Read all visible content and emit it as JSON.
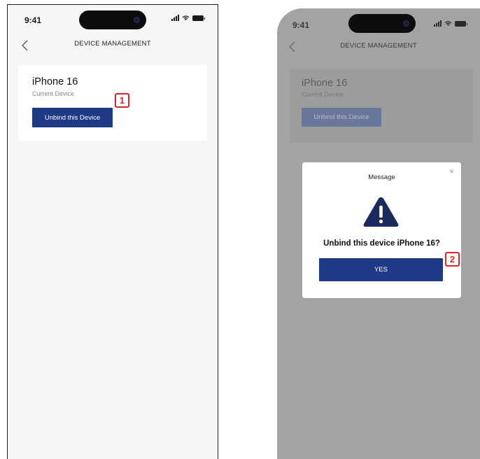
{
  "status_bar": {
    "time": "9:41"
  },
  "screen1": {
    "title": "DEVICE MANAGEMENT",
    "device_name": "iPhone 16",
    "device_subtitle": "Current Device",
    "unbind_label": "Unbind this Device",
    "step_marker": "1"
  },
  "screen2": {
    "title": "DEVICE MANAGEMENT",
    "device_name": "iPhone 16",
    "device_subtitle": "Current Device",
    "unbind_label": "Unbind this Device",
    "dialog": {
      "title": "Message",
      "close": "×",
      "question": "Unbind this device iPhone 16?",
      "yes_label": "YES"
    },
    "step_marker": "2"
  },
  "colors": {
    "primary": "#1e3a86",
    "overlay": "#a3a3a3",
    "marker": "#e02424",
    "warning_icon": "#1a2a5c"
  },
  "icons": [
    "back-chevron-icon",
    "signal-icon",
    "wifi-icon",
    "battery-icon",
    "warning-icon",
    "close-icon"
  ]
}
